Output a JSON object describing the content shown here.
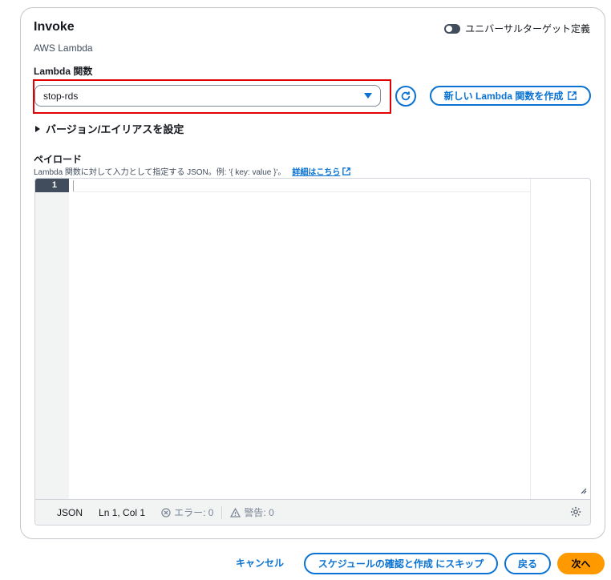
{
  "panel": {
    "title": "Invoke",
    "subtitle": "AWS Lambda",
    "universal_target_label": "ユニバーサルターゲット定義"
  },
  "lambda": {
    "label": "Lambda 関数",
    "selected_function": "stop-rds",
    "create_button_label": "新しい Lambda 関数を作成"
  },
  "version_alias": {
    "label": "バージョン/エイリアスを設定"
  },
  "payload": {
    "label": "ペイロード",
    "description": "Lambda 関数に対して入力として指定する JSON。例: '{ key: value }'。",
    "details_link": "詳細はこちら"
  },
  "editor": {
    "line_number": "1",
    "language": "JSON",
    "position": "Ln 1, Col 1",
    "errors": "エラー: 0",
    "warnings": "警告: 0"
  },
  "footer": {
    "cancel": "キャンセル",
    "skip": "スケジュールの確認と作成 にスキップ",
    "back": "戻る",
    "next": "次へ"
  },
  "colors": {
    "accent": "#0972d3",
    "primary_button": "#ff9900",
    "highlight_border": "#e00000"
  }
}
